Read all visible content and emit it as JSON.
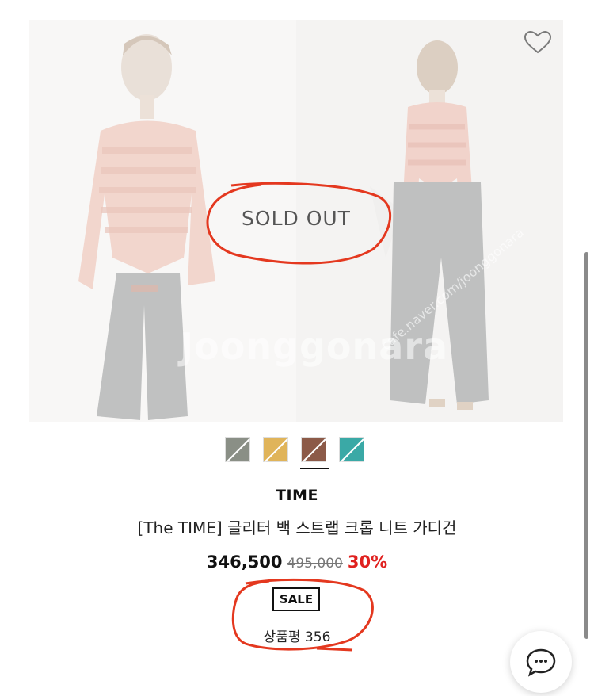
{
  "product": {
    "soldout_label": "SOLD OUT",
    "watermark": "Joonggonara",
    "watermark_url": "cafe.naver.com/joonggonara",
    "brand": "TIME",
    "name": "[The TIME] 글리터 백 스트랩 크롭 니트 가디건",
    "price_current": "346,500",
    "price_original": "495,000",
    "discount": "30%",
    "sale_badge": "SALE",
    "review_label": "상품평 356"
  },
  "swatches": [
    {
      "name": "swatch-khaki",
      "color": "#8a8f86",
      "selected": false
    },
    {
      "name": "swatch-yellow",
      "color": "#e0b45a",
      "selected": false
    },
    {
      "name": "swatch-brown",
      "color": "#8c5a48",
      "selected": true
    },
    {
      "name": "swatch-teal",
      "color": "#3aa9a6",
      "selected": false
    }
  ],
  "icons": {
    "wishlist": "heart-icon",
    "chat": "chat-bubble-icon"
  },
  "colors": {
    "discount": "#e0211f",
    "annotation": "#e4381f"
  }
}
